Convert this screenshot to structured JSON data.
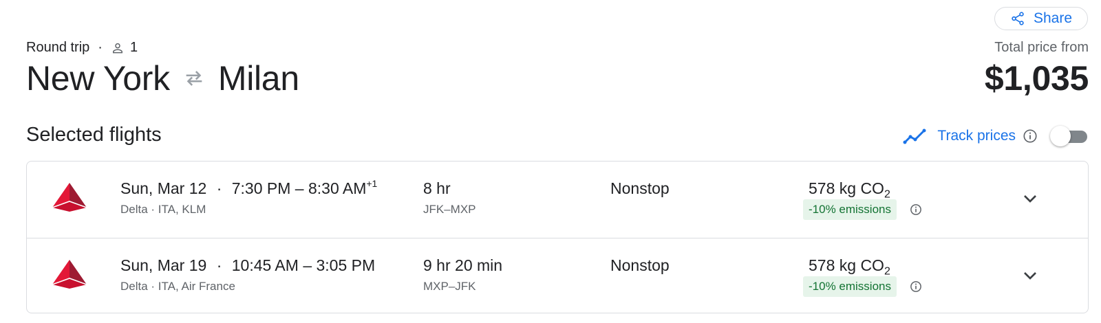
{
  "header": {
    "share_label": "Share",
    "trip_type": "Round trip",
    "separator": "·",
    "passengers": "1",
    "origin": "New York",
    "destination": "Milan",
    "total_label": "Total price from",
    "total_price": "$1,035"
  },
  "section": {
    "title": "Selected flights",
    "track_label": "Track prices",
    "track_enabled": false
  },
  "flights": [
    {
      "date": "Sun, Mar 12",
      "separator": "·",
      "times": "7:30 PM – 8:30 AM",
      "day_offset": "+1",
      "airline": "Delta · ITA, KLM",
      "duration": "8 hr",
      "airports": "JFK–MXP",
      "stops": "Nonstop",
      "co2_value": "578 kg CO",
      "co2_sub": "2",
      "emissions": "-10% emissions"
    },
    {
      "date": "Sun, Mar 19",
      "separator": "·",
      "times": "10:45 AM – 3:05 PM",
      "day_offset": "",
      "airline": "Delta · ITA, Air France",
      "duration": "9 hr 20 min",
      "airports": "MXP–JFK",
      "stops": "Nonstop",
      "co2_value": "578 kg CO",
      "co2_sub": "2",
      "emissions": "-10% emissions"
    }
  ],
  "colors": {
    "accent": "#1a73e8",
    "emissions_bg": "#e6f4ea",
    "emissions_text": "#137333",
    "delta_red": "#c8102e"
  }
}
